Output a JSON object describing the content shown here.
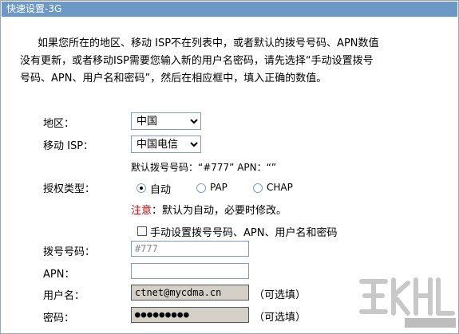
{
  "window": {
    "title": "快速设置-3G"
  },
  "intro": {
    "line1": "如果您所在的地区、移动 ISP不在列表中，或者默认的拨号号码、APN数值",
    "line2": "没有更新，或者移动ISP需要您输入新的用户名密码，请先选择“手动设置拨号",
    "line3": "号码、APN、用户名和密码”，然后在相应框中，填入正确的数值。"
  },
  "region": {
    "label": "地区：",
    "value": "中国"
  },
  "isp": {
    "label": "移动 ISP：",
    "value": "中国电信"
  },
  "defaults": {
    "text": "默认拨号号码：“#777”  APN：“”"
  },
  "auth": {
    "label": "授权类型：",
    "options": [
      "自动",
      "PAP",
      "CHAP"
    ],
    "selected": "自动",
    "note_prefix": "注意",
    "note_text": "：默认为自动，必要时修改。"
  },
  "manual": {
    "label": "手动设置拨号号码、APN、用户名和密码",
    "checked": false
  },
  "dial": {
    "label": "拨号号码：",
    "placeholder": "#777",
    "value": ""
  },
  "apn": {
    "label": "APN：",
    "value": ""
  },
  "username": {
    "label": "用户名：",
    "value": "ctnet@mycdma.cn",
    "hint": "（可选填）"
  },
  "password": {
    "label": "密码：",
    "value": "●●●●●●●●●",
    "hint": "（可选填）"
  },
  "colors": {
    "titlebar": "#6c99c4",
    "note": "#cc0000",
    "disabled_field": "#d4d0c8"
  }
}
